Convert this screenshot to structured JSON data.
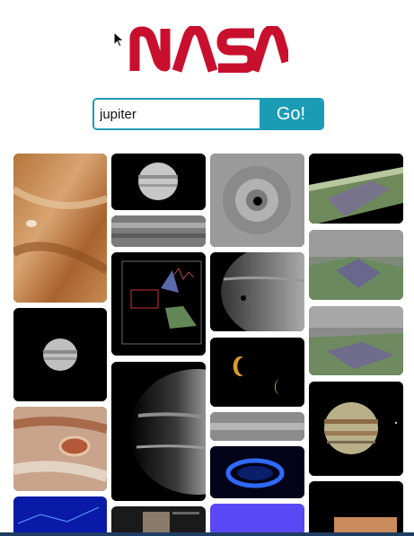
{
  "brand": {
    "logo_text": "NASA",
    "logo_color": "#c8102e"
  },
  "search": {
    "value": "jupiter",
    "placeholder": "",
    "button_label": "Go!",
    "accent": "#1b9cb5"
  },
  "results": {
    "thumbnails": [
      {
        "name": "jupiter-cloud-bands-closeup"
      },
      {
        "name": "jupiter-telescope-disk-small"
      },
      {
        "name": "jupiter-gray-swirl-pole"
      },
      {
        "name": "jupiter-3d-terrain-map"
      },
      {
        "name": "jupiter-banded-strip"
      },
      {
        "name": "jupiter-spectrum-chart"
      },
      {
        "name": "jupiter-3d-terrain-map-2"
      },
      {
        "name": "jupiter-moon-transit"
      },
      {
        "name": "jupiter-disk-dark-bg"
      },
      {
        "name": "jupiter-3d-strip"
      },
      {
        "name": "jupiter-crescent-moons"
      },
      {
        "name": "jupiter-great-red-spot"
      },
      {
        "name": "jupiter-color-disk"
      },
      {
        "name": "jupiter-half-lit-globe"
      },
      {
        "name": "jupiter-gray-strip"
      },
      {
        "name": "jupiter-blue-aurora"
      },
      {
        "name": "jupiter-blue-plot"
      },
      {
        "name": "jupiter-doc-thumbnail"
      },
      {
        "name": "jupiter-purple-tile"
      },
      {
        "name": "jupiter-orange-tile"
      }
    ]
  }
}
